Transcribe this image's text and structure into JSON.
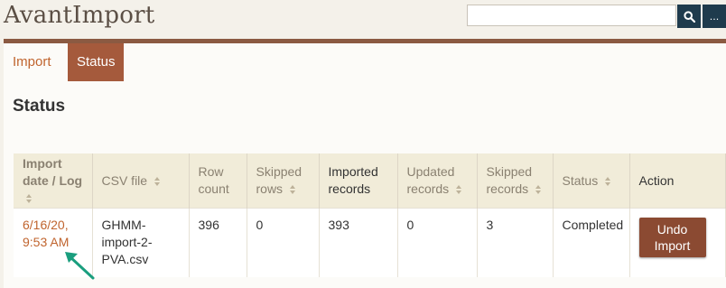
{
  "app": {
    "title": "AvantImport"
  },
  "search": {
    "placeholder": "",
    "more_label": "..."
  },
  "tabs": [
    {
      "label": "Import",
      "active": false
    },
    {
      "label": "Status",
      "active": true
    }
  ],
  "page": {
    "title": "Status"
  },
  "table": {
    "headers": [
      "Import date / Log",
      "CSV file",
      "Row count",
      "Skipped rows",
      "Imported records",
      "Updated records",
      "Skipped records",
      "Status",
      "Action"
    ],
    "rows": [
      {
        "date": "6/16/20, 9:53 AM",
        "csv_file": "GHMM-import-2-PVA.csv",
        "row_count": "396",
        "skipped_rows": "0",
        "imported_records": "393",
        "updated_records": "0",
        "skipped_records": "3",
        "status": "Completed",
        "action": "Undo Import"
      }
    ]
  },
  "colors": {
    "accent": "#a55a3c",
    "divider": "#8b5a42",
    "link": "#c0642e",
    "search_button": "#1f3b4d",
    "header_bg": "#f1ecd9",
    "annotation_arrow": "#1a9e7e"
  },
  "icons": {
    "search": "search-icon",
    "sort": "sort-icon",
    "annotation": "arrow-annotation-icon"
  }
}
